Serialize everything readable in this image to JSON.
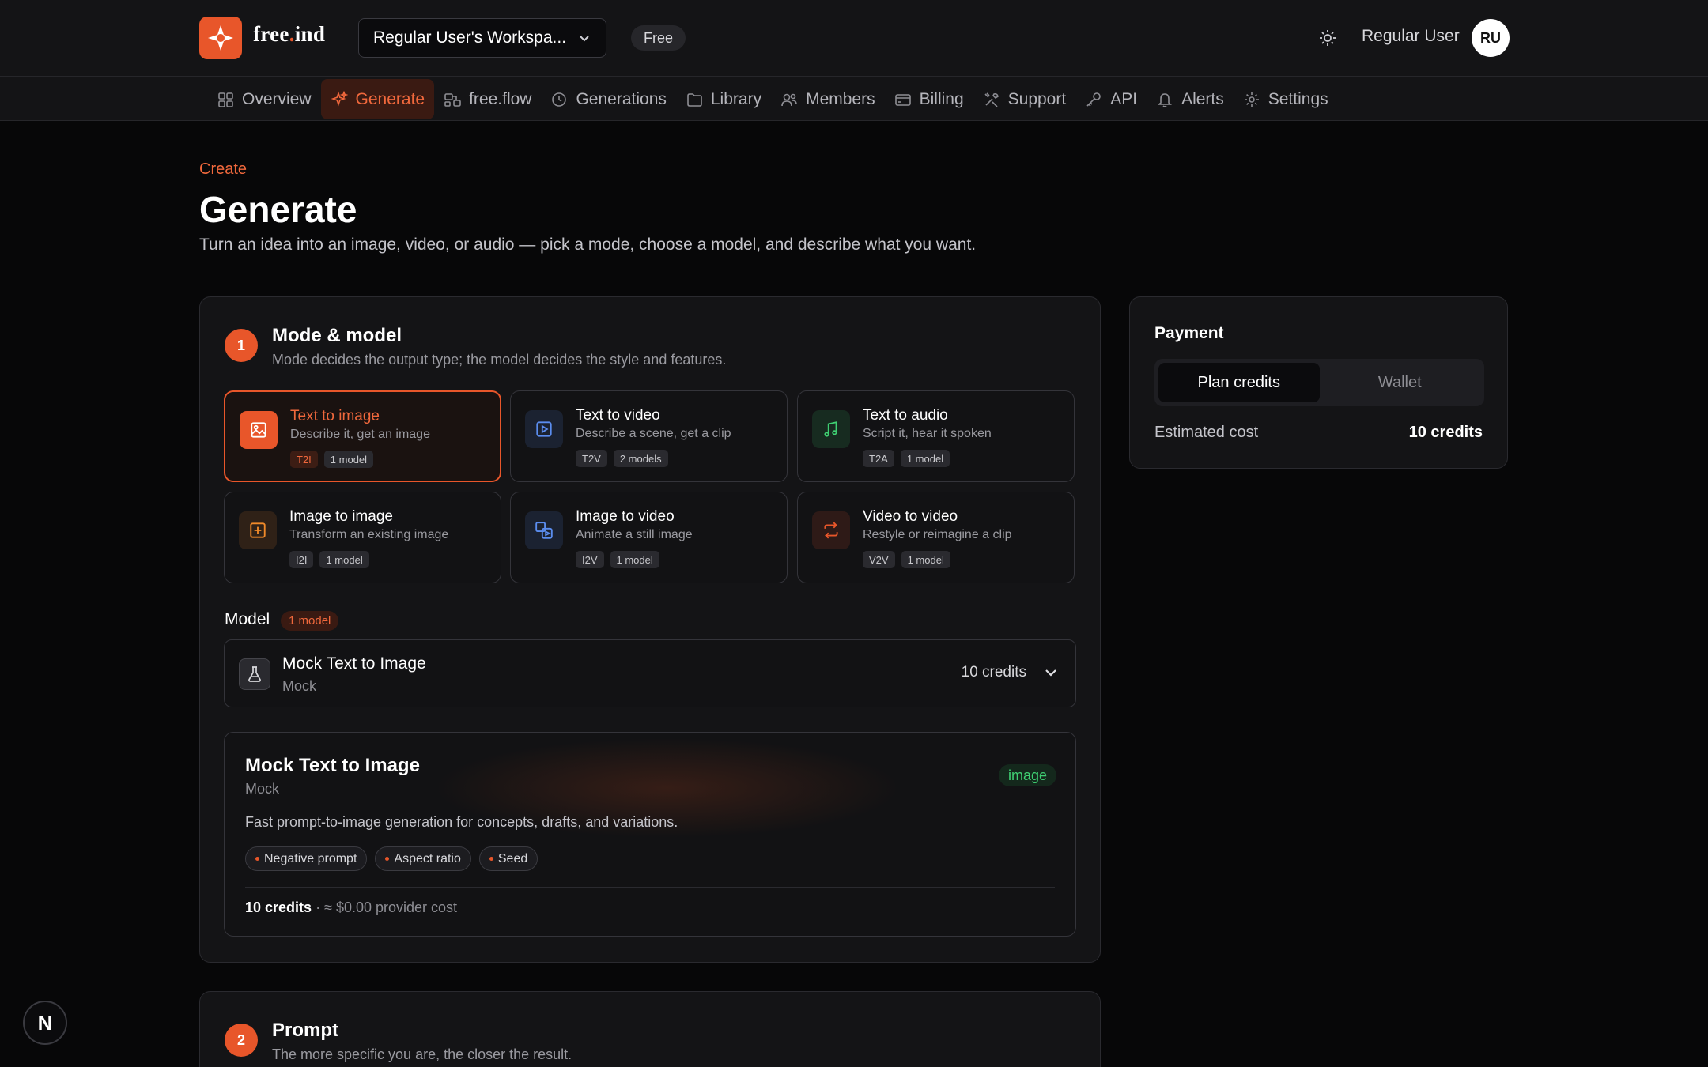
{
  "header": {
    "brand": "free",
    "brand_suffix": "ind",
    "workspace": "Regular User's Workspa...",
    "plan": "Free",
    "user_name": "Regular User",
    "avatar_initials": "RU"
  },
  "nav": [
    {
      "label": "Overview",
      "icon": "grid-icon",
      "active": false
    },
    {
      "label": "Generate",
      "icon": "sparkle-icon",
      "active": true
    },
    {
      "label": "free.flow",
      "icon": "flow-icon",
      "active": false
    },
    {
      "label": "Generations",
      "icon": "history-icon",
      "active": false
    },
    {
      "label": "Library",
      "icon": "folder-icon",
      "active": false
    },
    {
      "label": "Members",
      "icon": "users-icon",
      "active": false
    },
    {
      "label": "Billing",
      "icon": "card-icon",
      "active": false
    },
    {
      "label": "Support",
      "icon": "tools-icon",
      "active": false
    },
    {
      "label": "API",
      "icon": "key-icon",
      "active": false
    },
    {
      "label": "Alerts",
      "icon": "bell-icon",
      "active": false
    },
    {
      "label": "Settings",
      "icon": "gear-icon",
      "active": false
    }
  ],
  "page": {
    "eyebrow": "Create",
    "title": "Generate",
    "subtitle": "Turn an idea into an image, video, or audio — pick a mode, choose a model, and describe what you want."
  },
  "step1": {
    "number": "1",
    "title": "Mode & model",
    "subtitle": "Mode decides the output type; the model decides the style and features.",
    "modes": [
      {
        "title": "Text to image",
        "desc": "Describe it, get an image",
        "code": "T2I",
        "models": "1 model",
        "selected": true,
        "icon": "image-icon",
        "color": "#e8562a"
      },
      {
        "title": "Text to video",
        "desc": "Describe a scene, get a clip",
        "code": "T2V",
        "models": "2 models",
        "selected": false,
        "icon": "play-icon",
        "color": "#5b8def"
      },
      {
        "title": "Text to audio",
        "desc": "Script it, hear it spoken",
        "code": "T2A",
        "models": "1 model",
        "selected": false,
        "icon": "music-icon",
        "color": "#3fcf72"
      },
      {
        "title": "Image to image",
        "desc": "Transform an existing image",
        "code": "I2I",
        "models": "1 model",
        "selected": false,
        "icon": "image-plus-icon",
        "color": "#f08a2a"
      },
      {
        "title": "Image to video",
        "desc": "Animate a still image",
        "code": "I2V",
        "models": "1 model",
        "selected": false,
        "icon": "image-video-icon",
        "color": "#5b8def"
      },
      {
        "title": "Video to video",
        "desc": "Restyle or reimagine a clip",
        "code": "V2V",
        "models": "1 model",
        "selected": false,
        "icon": "repeat-icon",
        "color": "#e8562a"
      }
    ],
    "model_label": "Model",
    "model_count": "1 model",
    "selected_model": {
      "name": "Mock Text to Image",
      "provider": "Mock",
      "cost": "10 credits"
    },
    "detail": {
      "name": "Mock Text to Image",
      "provider": "Mock",
      "kind": "image",
      "description": "Fast prompt-to-image generation for concepts, drafts, and variations.",
      "features": [
        "Negative prompt",
        "Aspect ratio",
        "Seed"
      ],
      "cost_credits": "10 credits",
      "cost_rest": " · ≈ $0.00 provider cost"
    }
  },
  "step2": {
    "number": "2",
    "title": "Prompt",
    "subtitle": "The more specific you are, the closer the result."
  },
  "payment": {
    "title": "Payment",
    "tabs": [
      {
        "label": "Plan credits",
        "active": true
      },
      {
        "label": "Wallet",
        "active": false
      }
    ],
    "estimated_label": "Estimated cost",
    "estimated_value": "10 credits"
  },
  "dev_badge": "N"
}
